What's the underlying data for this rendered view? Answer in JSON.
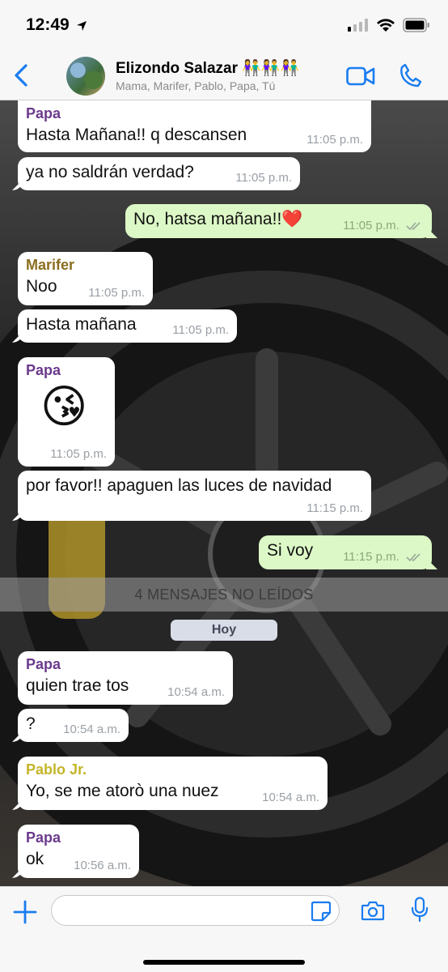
{
  "status_bar": {
    "time": "12:49"
  },
  "header": {
    "title": "Elizondo Salazar 👫👫👫",
    "subtitle": "Mama, Marifer, Pablo, Papa, Tú"
  },
  "colors": {
    "accent": "#1a7cf0",
    "papa": "#6b3a8c",
    "marifer": "#8a6d1e",
    "pablo": "#c4b52a",
    "in_bubble": "#ffffff",
    "out_bubble": "#dcf8c6"
  },
  "messages": [
    {
      "sender": "Papa",
      "text": "Hasta Mañana!! q descansen",
      "time": "11:05 p.m."
    },
    {
      "text": "ya no saldrán verdad?",
      "time": "11:05 p.m."
    },
    {
      "text": "No, hatsa mañana!!❤️",
      "time": "11:05 p.m."
    },
    {
      "sender": "Marifer",
      "text": "Noo",
      "time": "11:05 p.m."
    },
    {
      "text": "Hasta mañana",
      "time": "11:05 p.m."
    },
    {
      "sender": "Papa",
      "text": "😘",
      "time": "11:05 p.m."
    },
    {
      "text": "por favor!! apaguen las luces de navidad",
      "time": "11:15 p.m."
    },
    {
      "text": "Si voy",
      "time": "11:15 p.m."
    },
    {
      "sender": "Papa",
      "text": "quien trae tos",
      "time": "10:54 a.m."
    },
    {
      "text": "?",
      "time": "10:54 a.m."
    },
    {
      "sender": "Pablo Jr.",
      "text": "Yo, se me atorò una nuez",
      "time": "10:54 a.m."
    },
    {
      "sender": "Papa",
      "text": "ok",
      "time": "10:56 a.m."
    }
  ],
  "unread_banner": "4 MENSAJES NO LEÍDOS",
  "date_chip": "Hoy",
  "input": {
    "placeholder": ""
  },
  "icons": [
    "back-chevron-icon",
    "video-call-icon",
    "phone-icon",
    "plus-icon",
    "sticker-icon",
    "camera-icon",
    "mic-icon",
    "double-check-icon"
  ]
}
